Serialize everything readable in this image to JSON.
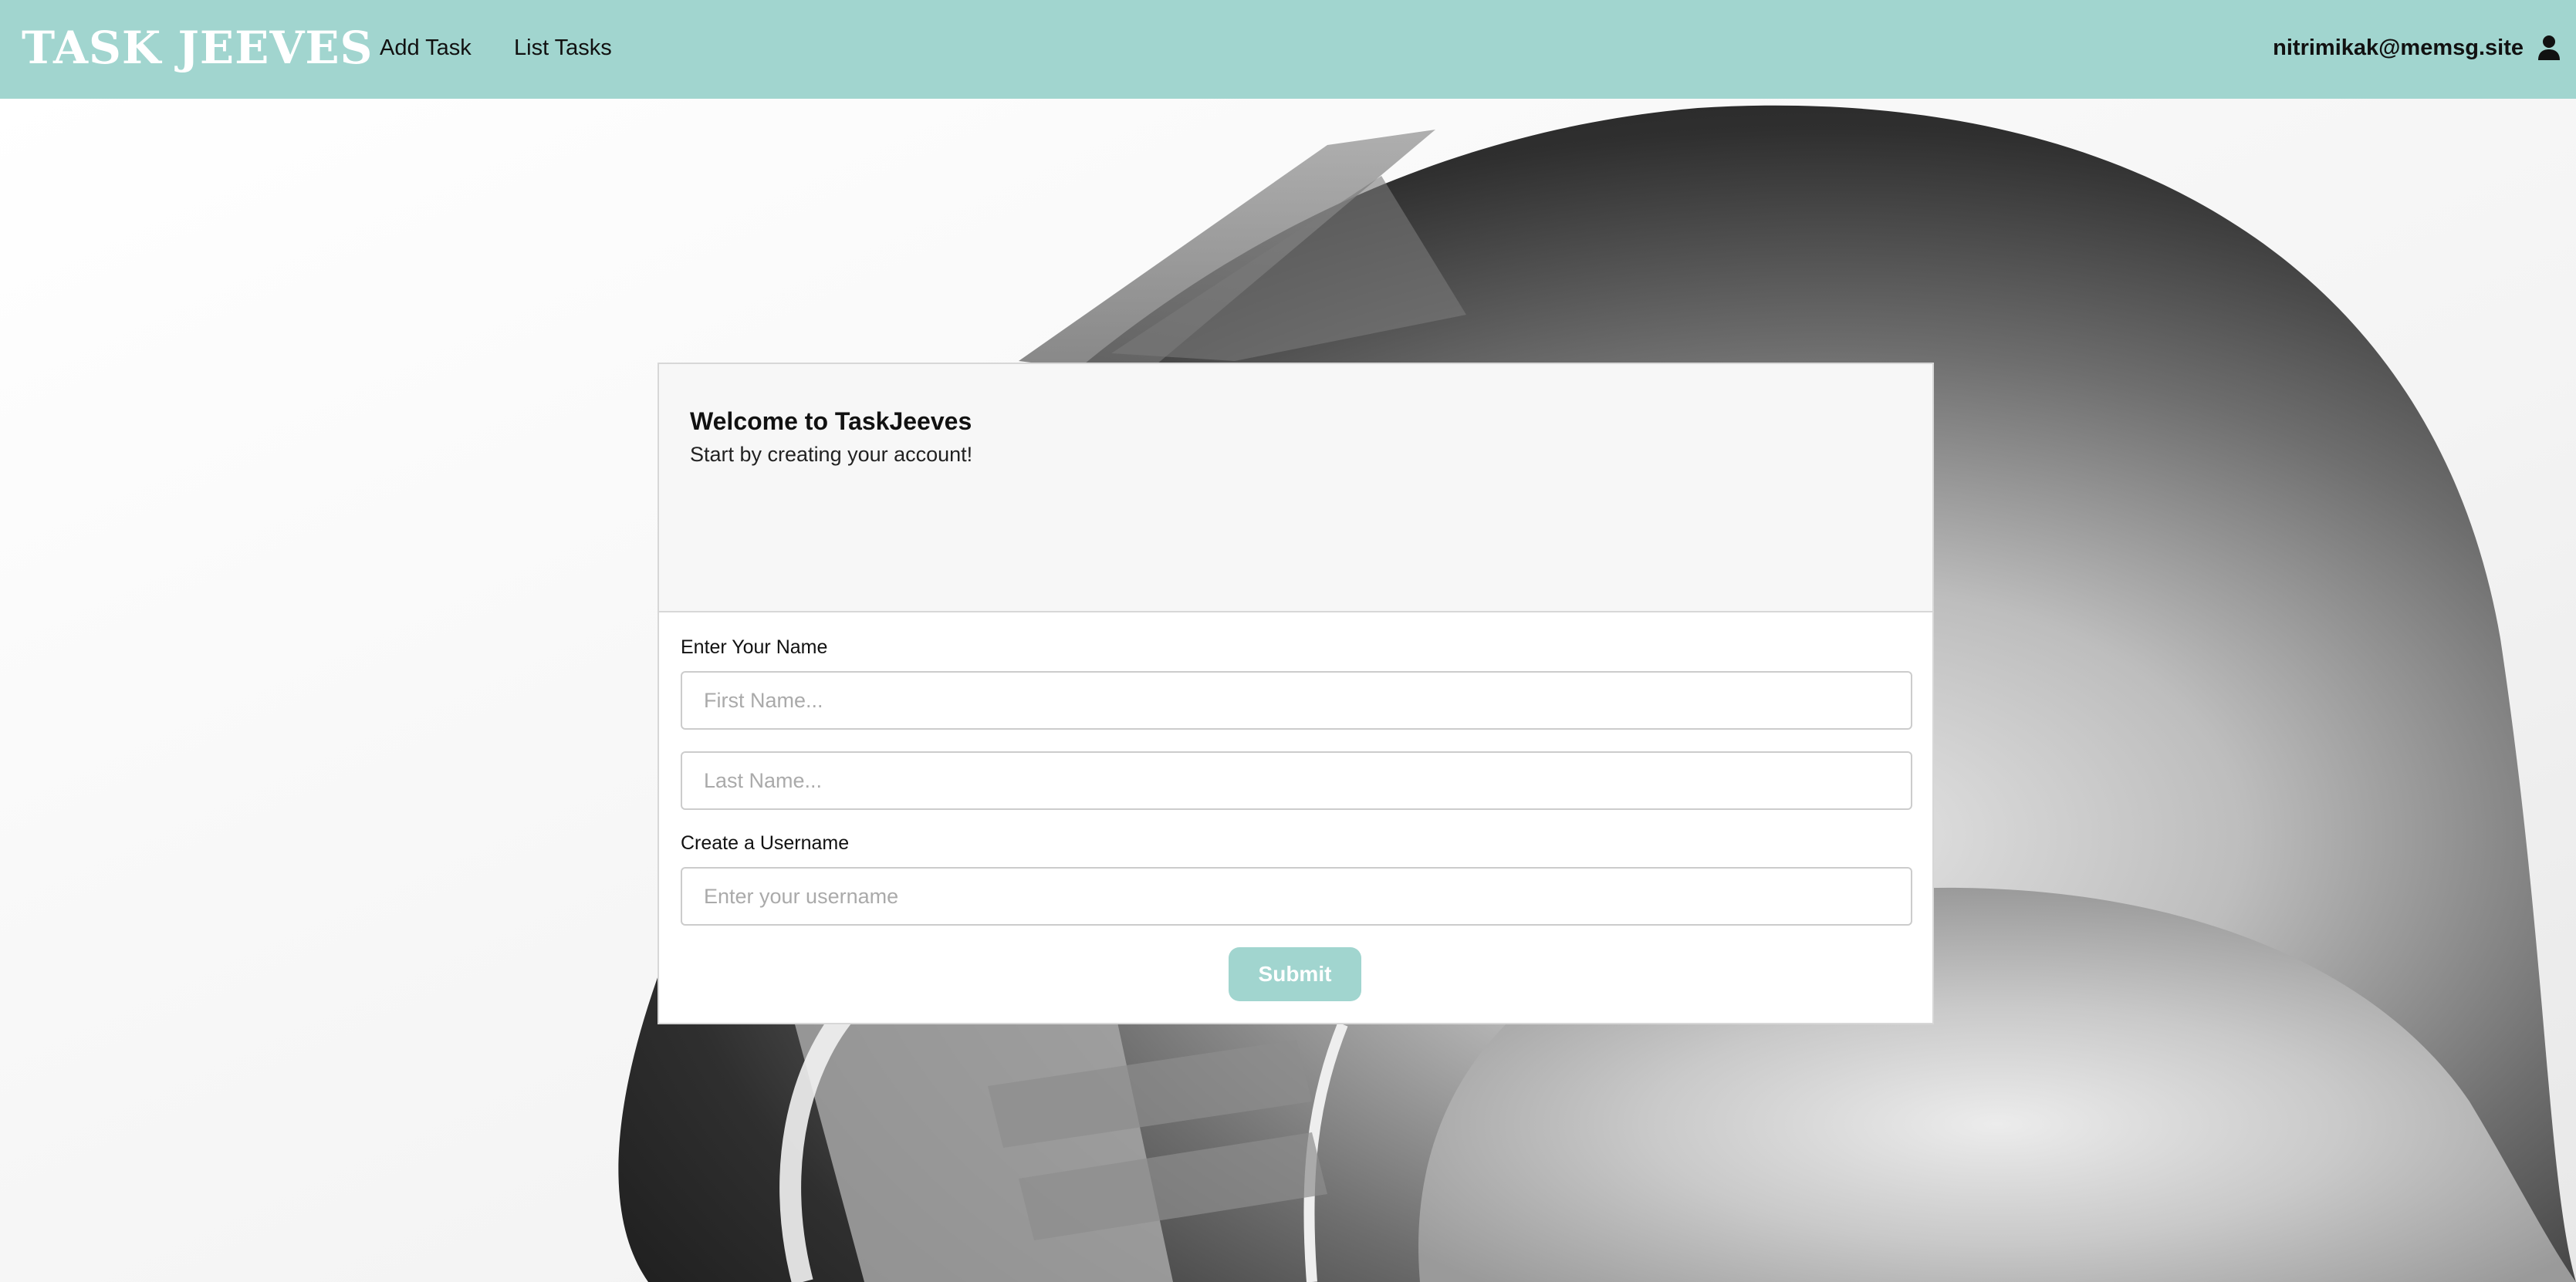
{
  "navbar": {
    "brand": "TASK JEEVES",
    "links": [
      {
        "label": "Add Task"
      },
      {
        "label": "List Tasks"
      }
    ],
    "user": {
      "email": "nitrimikak@memsg.site",
      "icon": "user-icon"
    }
  },
  "form_card": {
    "title": "Welcome to TaskJeeves",
    "subtitle": "Start by creating your account!",
    "name_label": "Enter Your Name",
    "first_name": {
      "value": "",
      "placeholder": "First Name..."
    },
    "last_name": {
      "value": "",
      "placeholder": "Last Name..."
    },
    "username_label": "Create a Username",
    "username": {
      "value": "",
      "placeholder": "Enter your username"
    },
    "submit_label": "Submit"
  },
  "colors": {
    "accent": "#a1d5cf",
    "card_header_bg": "#f7f7f7",
    "text_dark": "#111111"
  }
}
